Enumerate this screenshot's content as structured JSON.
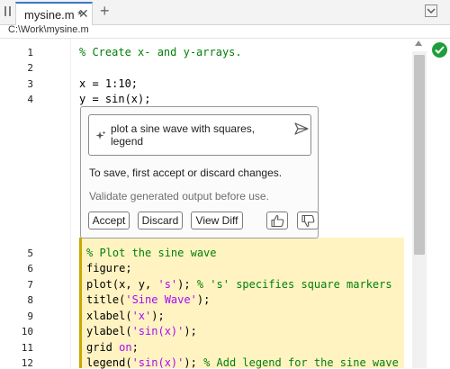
{
  "tabs": [
    {
      "title": "mysine.m *",
      "close_glyph": "✕",
      "active": true
    }
  ],
  "add_tab_glyph": "+",
  "breadcrumb": "C:\\Work\\mysine.m",
  "editor": {
    "lines": [
      {
        "num": "1",
        "parts": [
          {
            "text": "% Create x- and y-arrays.",
            "kind": "comment"
          }
        ]
      },
      {
        "num": "2",
        "parts": []
      },
      {
        "num": "3",
        "parts": [
          {
            "text": "x = 1:10;",
            "kind": "plain"
          }
        ]
      },
      {
        "num": "4",
        "parts": [
          {
            "text": "y = sin(x);",
            "kind": "plain"
          }
        ]
      }
    ],
    "generated_lines": [
      {
        "num": "5",
        "parts": [
          {
            "text": "% Plot the sine wave",
            "kind": "comment"
          }
        ]
      },
      {
        "num": "6",
        "parts": [
          {
            "text": "figure;",
            "kind": "plain"
          }
        ]
      },
      {
        "num": "7",
        "parts": [
          {
            "text": "plot(x, y, ",
            "kind": "plain"
          },
          {
            "text": "'s'",
            "kind": "string"
          },
          {
            "text": "); ",
            "kind": "plain"
          },
          {
            "text": "% 's' specifies square markers",
            "kind": "comment"
          }
        ]
      },
      {
        "num": "8",
        "parts": [
          {
            "text": "title(",
            "kind": "plain"
          },
          {
            "text": "'Sine Wave'",
            "kind": "string"
          },
          {
            "text": ");",
            "kind": "plain"
          }
        ]
      },
      {
        "num": "9",
        "parts": [
          {
            "text": "xlabel(",
            "kind": "plain"
          },
          {
            "text": "'x'",
            "kind": "string"
          },
          {
            "text": ");",
            "kind": "plain"
          }
        ]
      },
      {
        "num": "10",
        "parts": [
          {
            "text": "ylabel(",
            "kind": "plain"
          },
          {
            "text": "'sin(x)'",
            "kind": "string"
          },
          {
            "text": ");",
            "kind": "plain"
          }
        ]
      },
      {
        "num": "11",
        "parts": [
          {
            "text": "grid ",
            "kind": "plain"
          },
          {
            "text": "on",
            "kind": "string"
          },
          {
            "text": ";",
            "kind": "plain"
          }
        ]
      },
      {
        "num": "12",
        "parts": [
          {
            "text": "legend(",
            "kind": "plain"
          },
          {
            "text": "'sin(x)'",
            "kind": "string"
          },
          {
            "text": "); ",
            "kind": "plain"
          },
          {
            "text": "% Add legend for the sine wave",
            "kind": "comment"
          }
        ]
      }
    ],
    "colors": {
      "comment": "#028009",
      "string": "#a709f5",
      "generated_bg": "#fff3c2",
      "generated_bar": "#c9a800"
    }
  },
  "copilot": {
    "prompt": "plot a sine wave with squares, legend",
    "message": "To save, first accept or discard changes.",
    "disclaimer": "Validate generated output before use.",
    "accept_label": "Accept",
    "discard_label": "Discard",
    "view_diff_label": "View Diff",
    "icons": [
      "sparkle-icon",
      "send-icon",
      "thumbs-up-icon",
      "thumbs-down-icon"
    ]
  },
  "status_icon": "check-circle-icon"
}
